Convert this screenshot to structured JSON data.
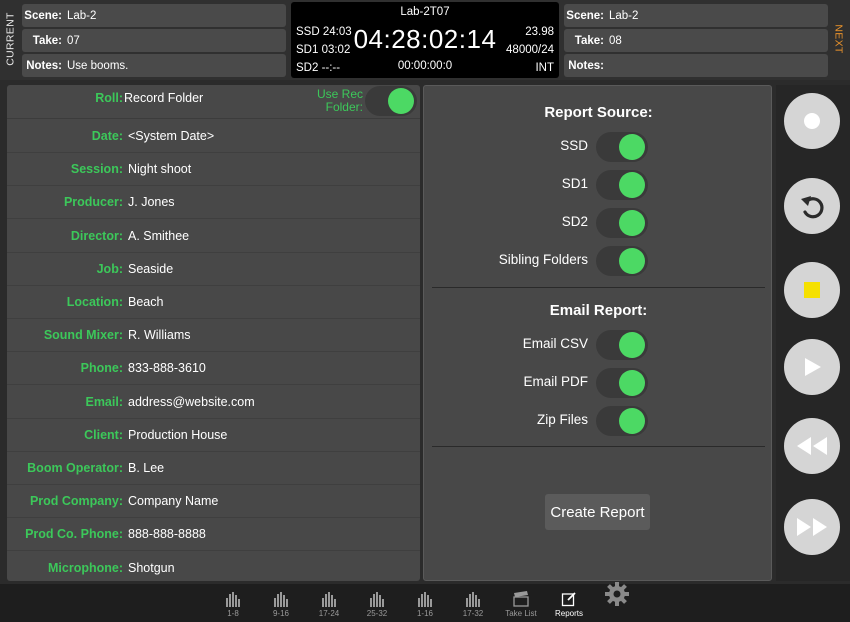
{
  "current_label": "CURRENT",
  "next_label": "NEXT",
  "current": {
    "scene_label": "Scene:",
    "scene": "Lab-2",
    "take_label": "Take:",
    "take": "07",
    "notes_label": "Notes:",
    "notes": "Use booms."
  },
  "next": {
    "scene_label": "Scene:",
    "scene": "Lab-2",
    "take_label": "Take:",
    "take": "08",
    "notes_label": "Notes:",
    "notes": ""
  },
  "timecode": {
    "file_name": "Lab-2T07",
    "ssd": "SSD 24:03",
    "sd1": "SD1 03:02",
    "sd2": "SD2 --:--",
    "main": "04:28:02:14",
    "elapsed": "00:00:00:0",
    "frame_rate": "23.98",
    "sample_rate": "48000/24",
    "sync": "INT"
  },
  "form": {
    "roll_label": "Roll:",
    "roll_value": "Record Folder",
    "use_rec_label_1": "Use Rec",
    "use_rec_label_2": "Folder:",
    "use_rec_folder": true,
    "fields": [
      {
        "label": "Date:",
        "value": "<System Date>"
      },
      {
        "label": "Session:",
        "value": "Night shoot"
      },
      {
        "label": "Producer:",
        "value": "J. Jones"
      },
      {
        "label": "Director:",
        "value": "A. Smithee"
      },
      {
        "label": "Job:",
        "value": "Seaside"
      },
      {
        "label": "Location:",
        "value": "Beach"
      },
      {
        "label": "Sound Mixer:",
        "value": "R. Williams"
      },
      {
        "label": "Phone:",
        "value": "833-888-3610"
      },
      {
        "label": "Email:",
        "value": "address@website.com"
      },
      {
        "label": "Client:",
        "value": "Production House"
      },
      {
        "label": "Boom Operator:",
        "value": "B. Lee"
      },
      {
        "label": "Prod Company:",
        "value": "Company Name"
      },
      {
        "label": "Prod Co. Phone:",
        "value": "888-888-8888"
      },
      {
        "label": "Microphone:",
        "value": "Shotgun"
      }
    ]
  },
  "report": {
    "source_title": "Report Source:",
    "sources": [
      {
        "label": "SSD",
        "on": true
      },
      {
        "label": "SD1",
        "on": true
      },
      {
        "label": "SD2",
        "on": true
      },
      {
        "label": "Sibling Folders",
        "on": true
      }
    ],
    "email_title": "Email Report:",
    "email_options": [
      {
        "label": "Email CSV",
        "on": true
      },
      {
        "label": "Email PDF",
        "on": true
      },
      {
        "label": "Zip Files",
        "on": true
      }
    ],
    "create_label": "Create Report"
  },
  "transport": [
    "record-icon",
    "undo-icon",
    "stop-icon",
    "play-icon",
    "rewind-icon",
    "fast-forward-icon"
  ],
  "colors": {
    "accent_green": "#4cd964",
    "label_green": "#3cc85a",
    "next_orange": "#e8922c",
    "stop_yellow": "#f5e000"
  },
  "tabs": [
    {
      "label": "1-8",
      "icon": "meters-icon"
    },
    {
      "label": "9-16",
      "icon": "meters-icon"
    },
    {
      "label": "17-24",
      "icon": "meters-icon"
    },
    {
      "label": "25-32",
      "icon": "meters-icon"
    },
    {
      "label": "1-16",
      "icon": "meters-icon"
    },
    {
      "label": "17-32",
      "icon": "meters-icon"
    },
    {
      "label": "Take List",
      "icon": "clapper-icon"
    },
    {
      "label": "Reports",
      "icon": "edit-icon",
      "active": true
    },
    {
      "label": "",
      "icon": "gear-icon"
    }
  ]
}
